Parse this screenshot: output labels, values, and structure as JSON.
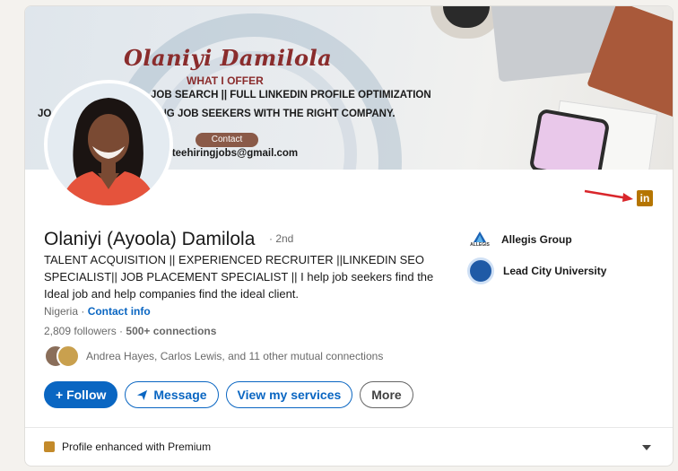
{
  "banner": {
    "name": "Olaniyi Damilola",
    "what_i_offer": "WHAT I OFFER",
    "line1": "JOB SEARCH || FULL LINKEDIN PROFILE OPTIMIZATION",
    "line2": "JO            RITING || LINKING JOB SEEKERS WITH THE RIGHT COMPANY.",
    "contact_label": "Contact",
    "email_fragment": "tteehiringjobs@gmail.com"
  },
  "profile": {
    "name": "Olaniyi (Ayoola) Damilola",
    "degree": "· 2nd",
    "headline": "TALENT ACQUISITION || EXPERIENCED RECRUITER ||LINKEDIN SEO SPECIALIST|| JOB PLACEMENT SPECIALIST || I help job seekers find the Ideal job and help companies find the ideal client.",
    "location": "Nigeria",
    "location_sep": " · ",
    "contact_info": "Contact info",
    "followers": "2,809 followers",
    "followers_sep": " · ",
    "connections": "500+ connections",
    "mutual_names_1": "Andrea Hayes",
    "mutual_names_sep": ", ",
    "mutual_names_2": "Carlos Lewis",
    "mutual_rest": ", and 11 other mutual connections"
  },
  "actions": {
    "follow": "+ Follow",
    "message": "Message",
    "services": "View my services",
    "more": "More"
  },
  "companies": [
    {
      "name": "Allegis Group",
      "logo_text": "ALLEGIS"
    },
    {
      "name": "Lead City University"
    }
  ],
  "linkedin_icon_text": "in",
  "footer": {
    "premium": "Profile enhanced with Premium"
  },
  "colors": {
    "accent": "#0a66c2",
    "premium": "#b57500",
    "arrow": "#d9262b"
  }
}
